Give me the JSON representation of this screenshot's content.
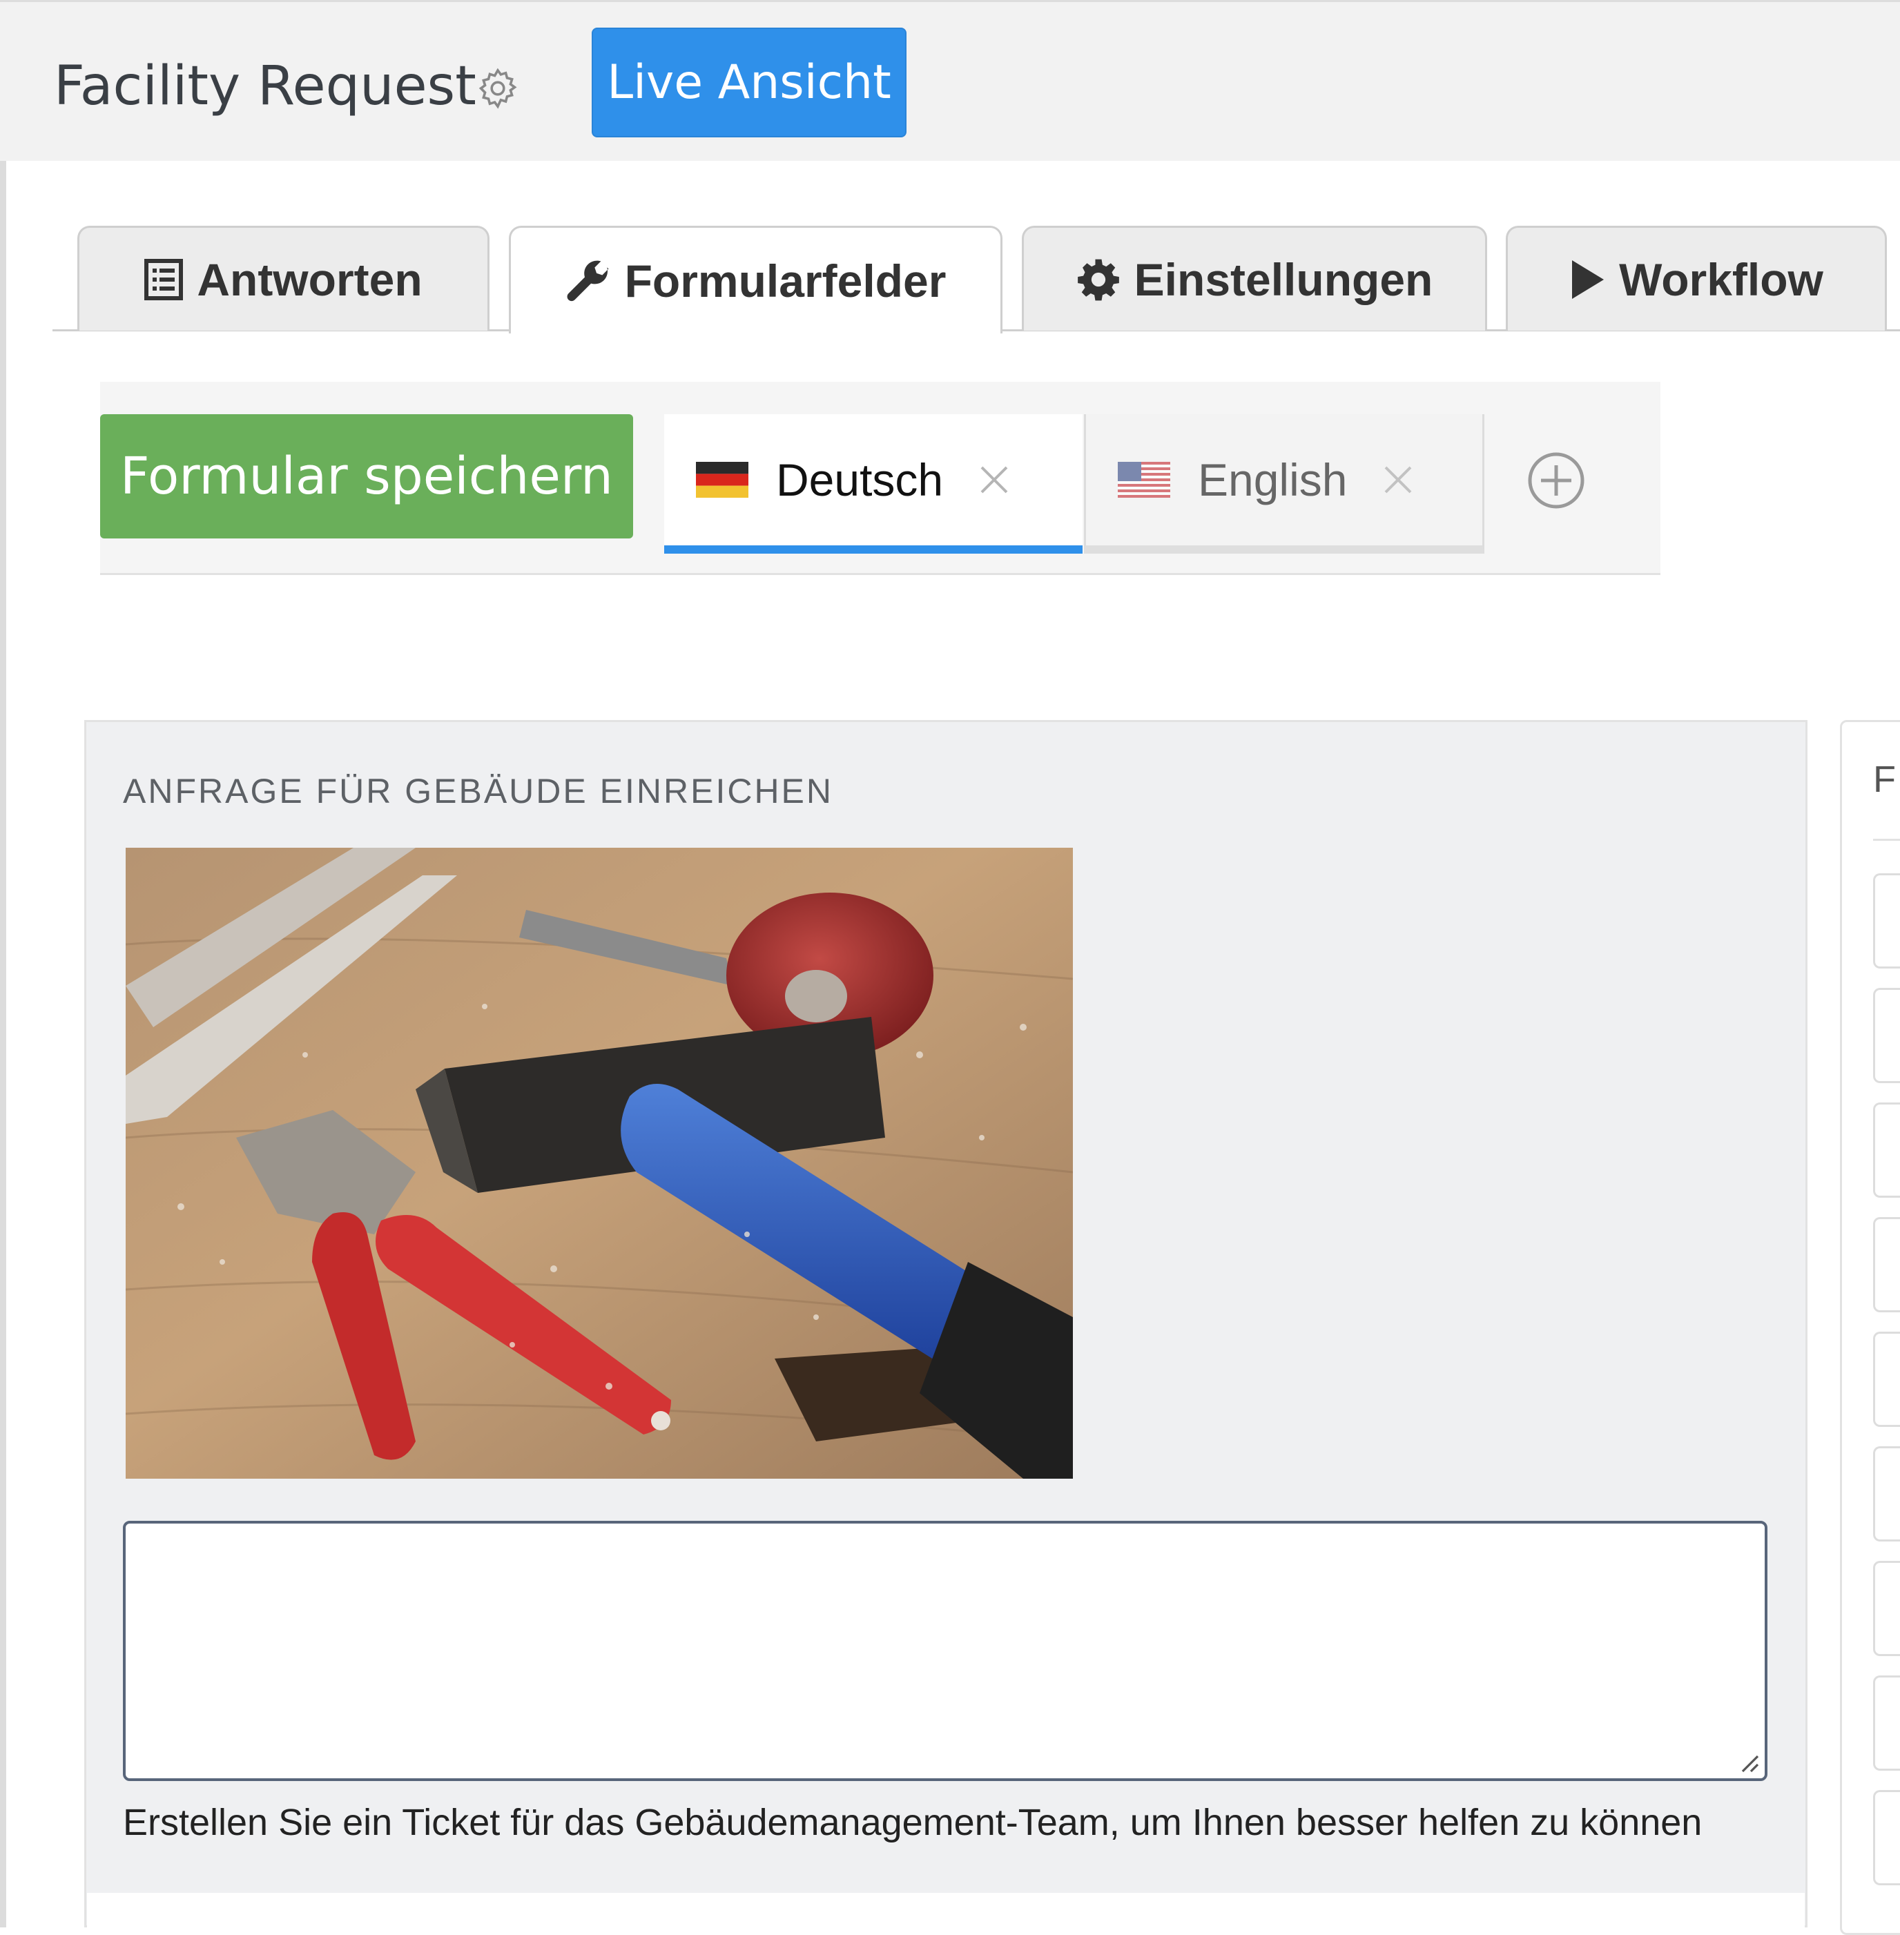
{
  "header": {
    "title": "Facility Request",
    "live_button": "Live Ansicht",
    "accent": "#2f90ea"
  },
  "tabs": [
    {
      "label": "Antworten",
      "icon": "list-icon",
      "active": false
    },
    {
      "label": "Formularfelder",
      "icon": "wrench-icon",
      "active": true
    },
    {
      "label": "Einstellungen",
      "icon": "gear-icon",
      "active": false
    },
    {
      "label": "Workflow",
      "icon": "play-icon",
      "active": false
    }
  ],
  "toolbar": {
    "save_label": "Formular speichern",
    "save_color": "#6aaf5a",
    "languages": [
      {
        "label": "Deutsch",
        "flag": "german-flag-icon",
        "active": true
      },
      {
        "label": "English",
        "flag": "us-flag-icon",
        "active": false
      }
    ]
  },
  "form": {
    "section_heading": "ANFRAGE FÜR GEBÄUDE EINREICHEN",
    "image": "tools-photo (hammer and pliers on workbench)",
    "textarea_value": "",
    "help_text": "Erstellen Sie ein Ticket für das Gebäudemanagement-Team, um Ihnen besser helfen zu können"
  },
  "side_panel": {
    "visible_letter": "F"
  }
}
